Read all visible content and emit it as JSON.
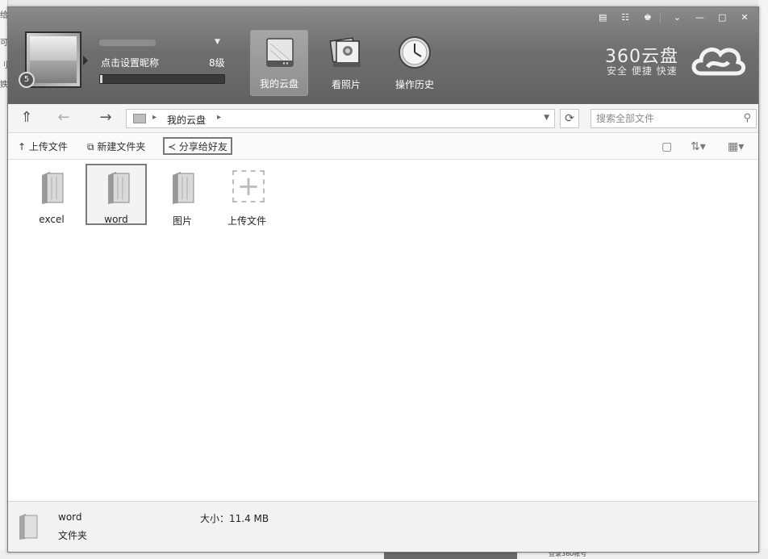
{
  "desktop": {
    "left_fragments": [
      "给",
      "可",
      "刂",
      "妷"
    ],
    "bottom_text": "登录360帐号"
  },
  "header": {
    "nickname_prompt": "点击设置昵称",
    "level": "8级",
    "level_badge": "5",
    "level_progress": 0.0,
    "nav": [
      {
        "label": "我的云盘",
        "icon": "drive-icon",
        "active": true
      },
      {
        "label": "看照片",
        "icon": "photos-icon",
        "active": false
      },
      {
        "label": "操作历史",
        "icon": "clock-icon",
        "active": false
      }
    ],
    "logo_text": "360云盘",
    "tagline": "安全 便捷 快速",
    "window_controls": [
      "▤",
      "☷",
      "♚",
      "⌄",
      "—",
      "□",
      "✕"
    ]
  },
  "address_bar": {
    "back": "←",
    "forward": "→",
    "up": "⇑",
    "breadcrumb": "我的云盘",
    "refresh": "⟳",
    "search_placeholder": "搜索全部文件"
  },
  "toolbar": {
    "upload": "上传文件",
    "new_folder": "新建文件夹",
    "share": "分享给好友"
  },
  "files": [
    {
      "name": "excel",
      "type": "folder",
      "selected": false
    },
    {
      "name": "word",
      "type": "folder",
      "selected": true
    },
    {
      "name": "图片",
      "type": "folder",
      "selected": false
    }
  ],
  "upload_tile": {
    "label": "上传文件"
  },
  "status": {
    "name": "word",
    "type": "文件夹",
    "size": "大小：11.4 MB"
  }
}
